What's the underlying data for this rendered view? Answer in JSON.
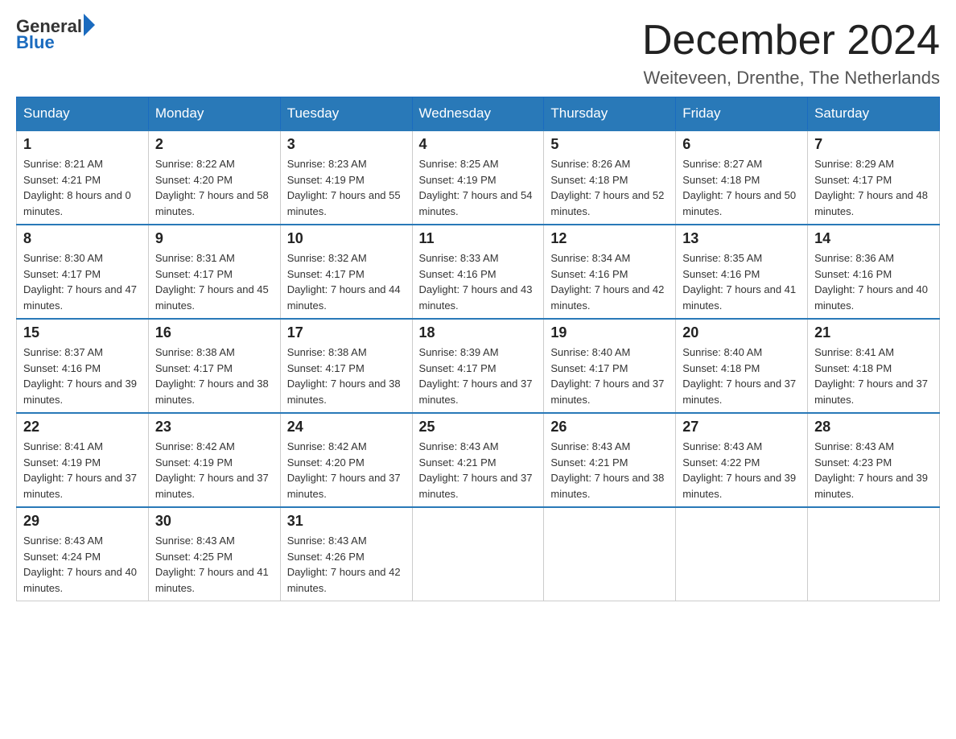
{
  "logo": {
    "text_general": "General",
    "text_blue": "Blue"
  },
  "header": {
    "month_year": "December 2024",
    "location": "Weiteveen, Drenthe, The Netherlands"
  },
  "days_of_week": [
    "Sunday",
    "Monday",
    "Tuesday",
    "Wednesday",
    "Thursday",
    "Friday",
    "Saturday"
  ],
  "weeks": [
    [
      {
        "day": "1",
        "sunrise": "Sunrise: 8:21 AM",
        "sunset": "Sunset: 4:21 PM",
        "daylight": "Daylight: 8 hours and 0 minutes."
      },
      {
        "day": "2",
        "sunrise": "Sunrise: 8:22 AM",
        "sunset": "Sunset: 4:20 PM",
        "daylight": "Daylight: 7 hours and 58 minutes."
      },
      {
        "day": "3",
        "sunrise": "Sunrise: 8:23 AM",
        "sunset": "Sunset: 4:19 PM",
        "daylight": "Daylight: 7 hours and 55 minutes."
      },
      {
        "day": "4",
        "sunrise": "Sunrise: 8:25 AM",
        "sunset": "Sunset: 4:19 PM",
        "daylight": "Daylight: 7 hours and 54 minutes."
      },
      {
        "day": "5",
        "sunrise": "Sunrise: 8:26 AM",
        "sunset": "Sunset: 4:18 PM",
        "daylight": "Daylight: 7 hours and 52 minutes."
      },
      {
        "day": "6",
        "sunrise": "Sunrise: 8:27 AM",
        "sunset": "Sunset: 4:18 PM",
        "daylight": "Daylight: 7 hours and 50 minutes."
      },
      {
        "day": "7",
        "sunrise": "Sunrise: 8:29 AM",
        "sunset": "Sunset: 4:17 PM",
        "daylight": "Daylight: 7 hours and 48 minutes."
      }
    ],
    [
      {
        "day": "8",
        "sunrise": "Sunrise: 8:30 AM",
        "sunset": "Sunset: 4:17 PM",
        "daylight": "Daylight: 7 hours and 47 minutes."
      },
      {
        "day": "9",
        "sunrise": "Sunrise: 8:31 AM",
        "sunset": "Sunset: 4:17 PM",
        "daylight": "Daylight: 7 hours and 45 minutes."
      },
      {
        "day": "10",
        "sunrise": "Sunrise: 8:32 AM",
        "sunset": "Sunset: 4:17 PM",
        "daylight": "Daylight: 7 hours and 44 minutes."
      },
      {
        "day": "11",
        "sunrise": "Sunrise: 8:33 AM",
        "sunset": "Sunset: 4:16 PM",
        "daylight": "Daylight: 7 hours and 43 minutes."
      },
      {
        "day": "12",
        "sunrise": "Sunrise: 8:34 AM",
        "sunset": "Sunset: 4:16 PM",
        "daylight": "Daylight: 7 hours and 42 minutes."
      },
      {
        "day": "13",
        "sunrise": "Sunrise: 8:35 AM",
        "sunset": "Sunset: 4:16 PM",
        "daylight": "Daylight: 7 hours and 41 minutes."
      },
      {
        "day": "14",
        "sunrise": "Sunrise: 8:36 AM",
        "sunset": "Sunset: 4:16 PM",
        "daylight": "Daylight: 7 hours and 40 minutes."
      }
    ],
    [
      {
        "day": "15",
        "sunrise": "Sunrise: 8:37 AM",
        "sunset": "Sunset: 4:16 PM",
        "daylight": "Daylight: 7 hours and 39 minutes."
      },
      {
        "day": "16",
        "sunrise": "Sunrise: 8:38 AM",
        "sunset": "Sunset: 4:17 PM",
        "daylight": "Daylight: 7 hours and 38 minutes."
      },
      {
        "day": "17",
        "sunrise": "Sunrise: 8:38 AM",
        "sunset": "Sunset: 4:17 PM",
        "daylight": "Daylight: 7 hours and 38 minutes."
      },
      {
        "day": "18",
        "sunrise": "Sunrise: 8:39 AM",
        "sunset": "Sunset: 4:17 PM",
        "daylight": "Daylight: 7 hours and 37 minutes."
      },
      {
        "day": "19",
        "sunrise": "Sunrise: 8:40 AM",
        "sunset": "Sunset: 4:17 PM",
        "daylight": "Daylight: 7 hours and 37 minutes."
      },
      {
        "day": "20",
        "sunrise": "Sunrise: 8:40 AM",
        "sunset": "Sunset: 4:18 PM",
        "daylight": "Daylight: 7 hours and 37 minutes."
      },
      {
        "day": "21",
        "sunrise": "Sunrise: 8:41 AM",
        "sunset": "Sunset: 4:18 PM",
        "daylight": "Daylight: 7 hours and 37 minutes."
      }
    ],
    [
      {
        "day": "22",
        "sunrise": "Sunrise: 8:41 AM",
        "sunset": "Sunset: 4:19 PM",
        "daylight": "Daylight: 7 hours and 37 minutes."
      },
      {
        "day": "23",
        "sunrise": "Sunrise: 8:42 AM",
        "sunset": "Sunset: 4:19 PM",
        "daylight": "Daylight: 7 hours and 37 minutes."
      },
      {
        "day": "24",
        "sunrise": "Sunrise: 8:42 AM",
        "sunset": "Sunset: 4:20 PM",
        "daylight": "Daylight: 7 hours and 37 minutes."
      },
      {
        "day": "25",
        "sunrise": "Sunrise: 8:43 AM",
        "sunset": "Sunset: 4:21 PM",
        "daylight": "Daylight: 7 hours and 37 minutes."
      },
      {
        "day": "26",
        "sunrise": "Sunrise: 8:43 AM",
        "sunset": "Sunset: 4:21 PM",
        "daylight": "Daylight: 7 hours and 38 minutes."
      },
      {
        "day": "27",
        "sunrise": "Sunrise: 8:43 AM",
        "sunset": "Sunset: 4:22 PM",
        "daylight": "Daylight: 7 hours and 39 minutes."
      },
      {
        "day": "28",
        "sunrise": "Sunrise: 8:43 AM",
        "sunset": "Sunset: 4:23 PM",
        "daylight": "Daylight: 7 hours and 39 minutes."
      }
    ],
    [
      {
        "day": "29",
        "sunrise": "Sunrise: 8:43 AM",
        "sunset": "Sunset: 4:24 PM",
        "daylight": "Daylight: 7 hours and 40 minutes."
      },
      {
        "day": "30",
        "sunrise": "Sunrise: 8:43 AM",
        "sunset": "Sunset: 4:25 PM",
        "daylight": "Daylight: 7 hours and 41 minutes."
      },
      {
        "day": "31",
        "sunrise": "Sunrise: 8:43 AM",
        "sunset": "Sunset: 4:26 PM",
        "daylight": "Daylight: 7 hours and 42 minutes."
      },
      null,
      null,
      null,
      null
    ]
  ]
}
